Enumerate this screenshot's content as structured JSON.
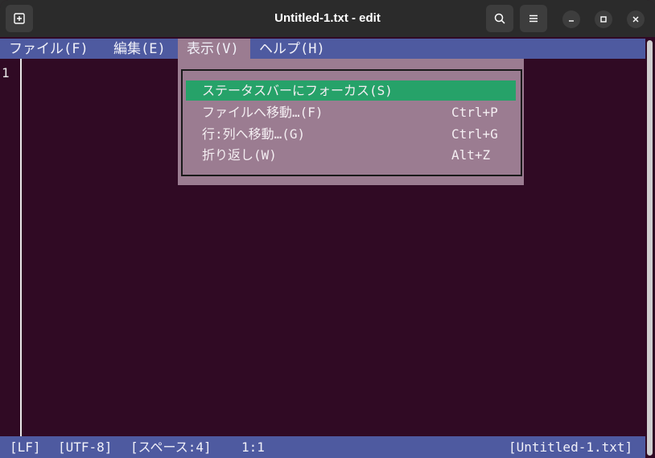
{
  "window": {
    "title": "Untitled-1.txt - edit"
  },
  "menubar": {
    "items": [
      {
        "label": "ファイル(F)"
      },
      {
        "label": "編集(E)"
      },
      {
        "label": "表示(V)"
      },
      {
        "label": "ヘルプ(H)"
      }
    ]
  },
  "editor": {
    "line_numbers": [
      "1"
    ]
  },
  "dropdown": {
    "items": [
      {
        "label": "ステータスバーにフォーカス(S)",
        "shortcut": ""
      },
      {
        "label": "ファイルへ移動…(F)",
        "shortcut": "Ctrl+P"
      },
      {
        "label": "行:列へ移動…(G)",
        "shortcut": "Ctrl+G"
      },
      {
        "label": "折り返し(W)",
        "shortcut": "Alt+Z"
      }
    ]
  },
  "statusbar": {
    "line_ending": "[LF]",
    "encoding": "[UTF-8]",
    "indent": "[スペース:4]",
    "cursor": "1:1",
    "filename": "[Untitled-1.txt]"
  },
  "icons": {
    "new_tab": "new-tab-icon",
    "search": "search-icon",
    "menu": "hamburger-menu-icon",
    "minimize": "minimize-icon",
    "maximize": "maximize-icon",
    "close": "close-icon"
  },
  "colors": {
    "background": "#300a24",
    "bar": "#4e5aa0",
    "menu_highlight": "#9b7c91",
    "selection": "#26a269"
  }
}
